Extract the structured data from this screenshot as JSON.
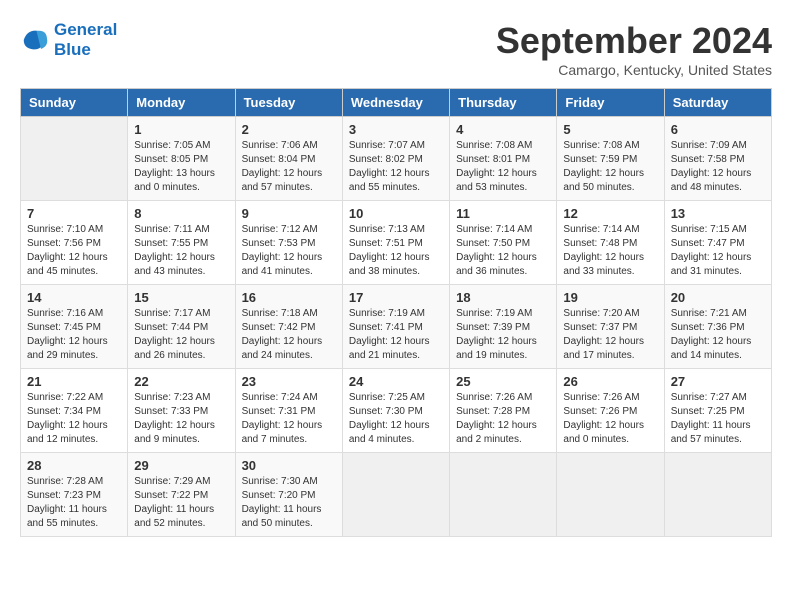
{
  "logo": {
    "line1": "General",
    "line2": "Blue"
  },
  "title": "September 2024",
  "subtitle": "Camargo, Kentucky, United States",
  "weekdays": [
    "Sunday",
    "Monday",
    "Tuesday",
    "Wednesday",
    "Thursday",
    "Friday",
    "Saturday"
  ],
  "days": [
    {
      "num": "",
      "info": ""
    },
    {
      "num": "1",
      "info": "Sunrise: 7:05 AM\nSunset: 8:05 PM\nDaylight: 13 hours\nand 0 minutes."
    },
    {
      "num": "2",
      "info": "Sunrise: 7:06 AM\nSunset: 8:04 PM\nDaylight: 12 hours\nand 57 minutes."
    },
    {
      "num": "3",
      "info": "Sunrise: 7:07 AM\nSunset: 8:02 PM\nDaylight: 12 hours\nand 55 minutes."
    },
    {
      "num": "4",
      "info": "Sunrise: 7:08 AM\nSunset: 8:01 PM\nDaylight: 12 hours\nand 53 minutes."
    },
    {
      "num": "5",
      "info": "Sunrise: 7:08 AM\nSunset: 7:59 PM\nDaylight: 12 hours\nand 50 minutes."
    },
    {
      "num": "6",
      "info": "Sunrise: 7:09 AM\nSunset: 7:58 PM\nDaylight: 12 hours\nand 48 minutes."
    },
    {
      "num": "7",
      "info": "Sunrise: 7:10 AM\nSunset: 7:56 PM\nDaylight: 12 hours\nand 45 minutes."
    },
    {
      "num": "8",
      "info": "Sunrise: 7:11 AM\nSunset: 7:55 PM\nDaylight: 12 hours\nand 43 minutes."
    },
    {
      "num": "9",
      "info": "Sunrise: 7:12 AM\nSunset: 7:53 PM\nDaylight: 12 hours\nand 41 minutes."
    },
    {
      "num": "10",
      "info": "Sunrise: 7:13 AM\nSunset: 7:51 PM\nDaylight: 12 hours\nand 38 minutes."
    },
    {
      "num": "11",
      "info": "Sunrise: 7:14 AM\nSunset: 7:50 PM\nDaylight: 12 hours\nand 36 minutes."
    },
    {
      "num": "12",
      "info": "Sunrise: 7:14 AM\nSunset: 7:48 PM\nDaylight: 12 hours\nand 33 minutes."
    },
    {
      "num": "13",
      "info": "Sunrise: 7:15 AM\nSunset: 7:47 PM\nDaylight: 12 hours\nand 31 minutes."
    },
    {
      "num": "14",
      "info": "Sunrise: 7:16 AM\nSunset: 7:45 PM\nDaylight: 12 hours\nand 29 minutes."
    },
    {
      "num": "15",
      "info": "Sunrise: 7:17 AM\nSunset: 7:44 PM\nDaylight: 12 hours\nand 26 minutes."
    },
    {
      "num": "16",
      "info": "Sunrise: 7:18 AM\nSunset: 7:42 PM\nDaylight: 12 hours\nand 24 minutes."
    },
    {
      "num": "17",
      "info": "Sunrise: 7:19 AM\nSunset: 7:41 PM\nDaylight: 12 hours\nand 21 minutes."
    },
    {
      "num": "18",
      "info": "Sunrise: 7:19 AM\nSunset: 7:39 PM\nDaylight: 12 hours\nand 19 minutes."
    },
    {
      "num": "19",
      "info": "Sunrise: 7:20 AM\nSunset: 7:37 PM\nDaylight: 12 hours\nand 17 minutes."
    },
    {
      "num": "20",
      "info": "Sunrise: 7:21 AM\nSunset: 7:36 PM\nDaylight: 12 hours\nand 14 minutes."
    },
    {
      "num": "21",
      "info": "Sunrise: 7:22 AM\nSunset: 7:34 PM\nDaylight: 12 hours\nand 12 minutes."
    },
    {
      "num": "22",
      "info": "Sunrise: 7:23 AM\nSunset: 7:33 PM\nDaylight: 12 hours\nand 9 minutes."
    },
    {
      "num": "23",
      "info": "Sunrise: 7:24 AM\nSunset: 7:31 PM\nDaylight: 12 hours\nand 7 minutes."
    },
    {
      "num": "24",
      "info": "Sunrise: 7:25 AM\nSunset: 7:30 PM\nDaylight: 12 hours\nand 4 minutes."
    },
    {
      "num": "25",
      "info": "Sunrise: 7:26 AM\nSunset: 7:28 PM\nDaylight: 12 hours\nand 2 minutes."
    },
    {
      "num": "26",
      "info": "Sunrise: 7:26 AM\nSunset: 7:26 PM\nDaylight: 12 hours\nand 0 minutes."
    },
    {
      "num": "27",
      "info": "Sunrise: 7:27 AM\nSunset: 7:25 PM\nDaylight: 11 hours\nand 57 minutes."
    },
    {
      "num": "28",
      "info": "Sunrise: 7:28 AM\nSunset: 7:23 PM\nDaylight: 11 hours\nand 55 minutes."
    },
    {
      "num": "29",
      "info": "Sunrise: 7:29 AM\nSunset: 7:22 PM\nDaylight: 11 hours\nand 52 minutes."
    },
    {
      "num": "30",
      "info": "Sunrise: 7:30 AM\nSunset: 7:20 PM\nDaylight: 11 hours\nand 50 minutes."
    },
    {
      "num": "",
      "info": ""
    },
    {
      "num": "",
      "info": ""
    },
    {
      "num": "",
      "info": ""
    },
    {
      "num": "",
      "info": ""
    },
    {
      "num": "",
      "info": ""
    }
  ]
}
